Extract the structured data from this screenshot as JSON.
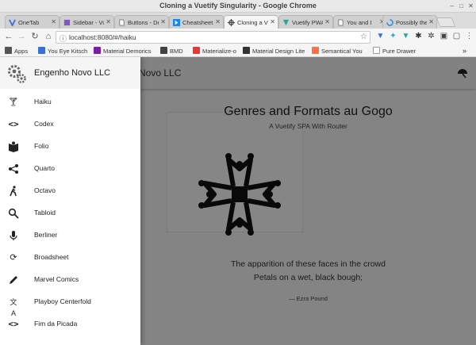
{
  "window": {
    "title": "Cloning a Vuetify Singularity - Google Chrome"
  },
  "tabs": [
    {
      "label": "OneTab",
      "fav": "#3b6fd8"
    },
    {
      "label": "Sidebar - Vuetify",
      "fav": "#7e57c2"
    },
    {
      "label": "Buttons - Deploy",
      "fav": "#9e9e9e"
    },
    {
      "label": "Cheatsheet",
      "fav": "#1e88e5"
    },
    {
      "label": "Cloning a Vuetify",
      "fav": "#444444"
    },
    {
      "label": "Vuetify PWA",
      "fav": "#26a69a"
    },
    {
      "label": "You and I",
      "fav": "#9e9e9e"
    },
    {
      "label": "Possibly the",
      "fav": "#1e88e5"
    }
  ],
  "address_bar": {
    "url": "localhost:8080/#/haiku"
  },
  "bookmarks": [
    {
      "label": "Apps",
      "color": "#555555"
    },
    {
      "label": "You Eye Kitsch",
      "color": "#3b6fd8"
    },
    {
      "label": "Material Demorics",
      "color": "#7b1fa2"
    },
    {
      "label": "BMD",
      "color": "#424242"
    },
    {
      "label": "Materialize-o",
      "color": "#e53935"
    },
    {
      "label": "Material Design Lite",
      "color": "#333333"
    },
    {
      "label": "Semantical You",
      "color": "#ff7043"
    },
    {
      "label": "Pure Drawer",
      "color": "#9e9e9e"
    }
  ],
  "app": {
    "toolbar_title": "Novo LLC",
    "brand": "Engenho Novo LLC",
    "heading": "Genres and Formats au Gogo",
    "subheading": "A Vuetify SPA With Router",
    "poem": [
      "The apparition of these faces in the crowd",
      "Petals on a wet, black bough;"
    ],
    "attribution": "— Ezra Pound"
  },
  "nav": [
    {
      "label": "Haiku",
      "icon": "cocktail-glass-icon"
    },
    {
      "label": "Codex",
      "icon": "code-icon"
    },
    {
      "label": "Folio",
      "icon": "book-icon"
    },
    {
      "label": "Quarto",
      "icon": "share-icon"
    },
    {
      "label": "Octavo",
      "icon": "walk-icon"
    },
    {
      "label": "Tabloid",
      "icon": "search-icon"
    },
    {
      "label": "Berliner",
      "icon": "microphone-icon"
    },
    {
      "label": "Broadsheet",
      "icon": "sync-icon"
    },
    {
      "label": "Marvel Comics",
      "icon": "pencil-icon"
    },
    {
      "label": "Playboy Centerfold",
      "icon": "translate-icon"
    },
    {
      "label": "Fim da Picada",
      "icon": "code-icon"
    }
  ]
}
